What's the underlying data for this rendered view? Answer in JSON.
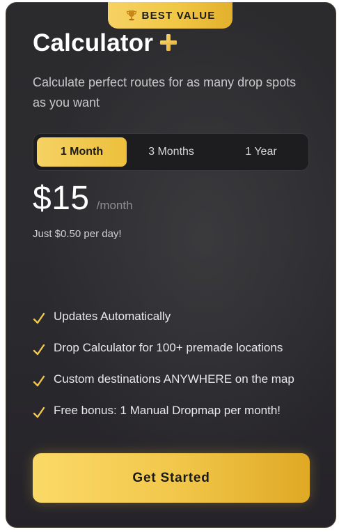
{
  "badge": {
    "icon": "trophy-icon",
    "text": "BEST VALUE"
  },
  "plan": {
    "name": "Calculator",
    "name_icon": "plus-icon",
    "description": "Calculate perfect routes for as many drop spots as you want"
  },
  "billing_tabs": [
    {
      "label": "1 Month",
      "active": true
    },
    {
      "label": "3 Months",
      "active": false
    },
    {
      "label": "1 Year",
      "active": false
    }
  ],
  "pricing": {
    "price": "$15",
    "period": "/month",
    "per_day_note": "Just $0.50 per day!"
  },
  "features": [
    {
      "icon": "check-icon",
      "text": "Updates Automatically"
    },
    {
      "icon": "check-icon",
      "text": "Drop Calculator for 100+ premade locations"
    },
    {
      "icon": "check-icon",
      "text": "Custom destinations ANYWHERE on the map"
    },
    {
      "icon": "check-icon",
      "text": "Free bonus: 1 Manual Dropmap per month!"
    }
  ],
  "cta": {
    "label": "Get Started"
  },
  "colors": {
    "accent": "#f2c84c",
    "card_background": "#2b2b2e",
    "text_primary": "#ffffff"
  }
}
